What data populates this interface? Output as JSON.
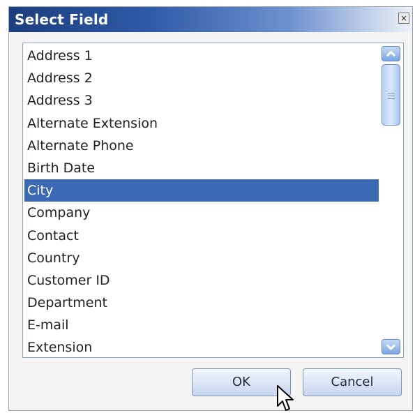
{
  "window": {
    "title": "Select Field",
    "close_glyph": "×"
  },
  "list": {
    "items": [
      "Address 1",
      "Address 2",
      "Address 3",
      "Alternate Extension",
      "Alternate Phone",
      "Birth Date",
      "City",
      "Company",
      "Contact",
      "Country",
      "Customer ID",
      "Department",
      "E-mail",
      "Extension"
    ],
    "selected_index": 6
  },
  "buttons": {
    "ok_label": "OK",
    "cancel_label": "Cancel"
  },
  "icons": {
    "scroll_up": "chevron-up-icon",
    "scroll_down": "chevron-down-icon",
    "cursor": "mouse-pointer-icon"
  },
  "colors": {
    "selection": "#3b69b3",
    "titlebar": "#1d3d7d"
  }
}
